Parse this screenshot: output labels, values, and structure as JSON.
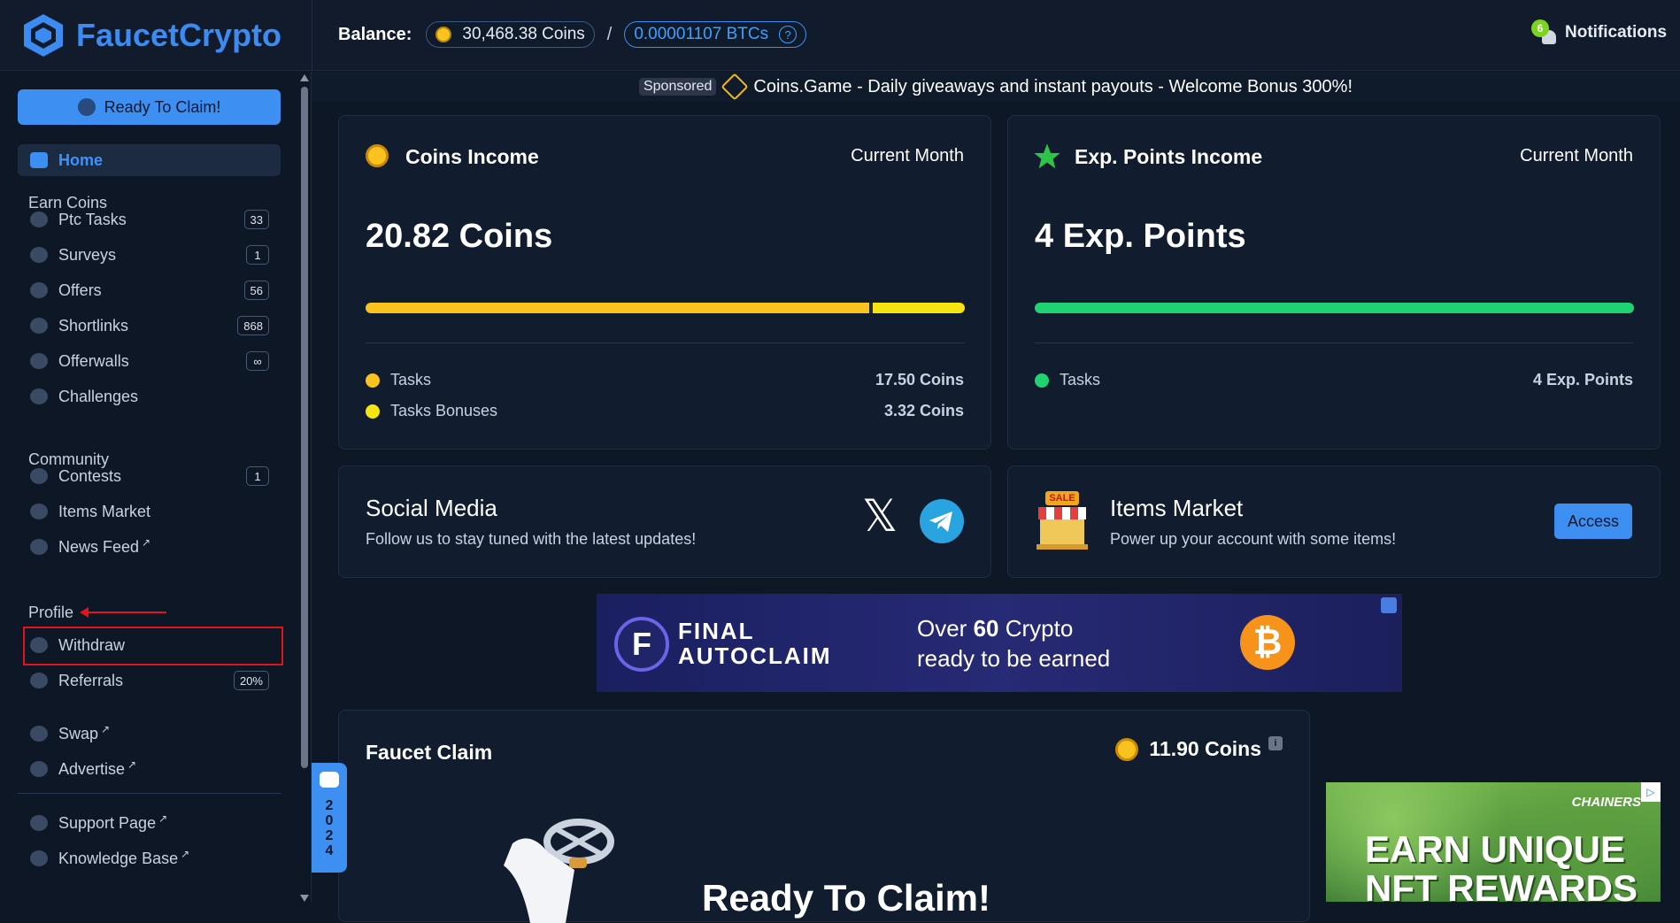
{
  "header": {
    "logo_text": "FaucetCrypto",
    "balance_label": "Balance:",
    "coins_balance": "30,468.38 Coins",
    "separator": "/",
    "btc_balance": "0.00001107 BTCs",
    "help_glyph": "?",
    "notifications_label": "Notifications",
    "notifications_count": "6"
  },
  "sidebar": {
    "claim_button": "Ready To Claim!",
    "home": "Home",
    "earn_section": "Earn Coins",
    "earn_items": [
      {
        "label": "Ptc Tasks",
        "badge": "33",
        "icon": "eye-icon"
      },
      {
        "label": "Surveys",
        "badge": "1",
        "icon": "survey-icon"
      },
      {
        "label": "Offers",
        "badge": "56",
        "icon": "offers-icon"
      },
      {
        "label": "Shortlinks",
        "badge": "868",
        "icon": "link-icon"
      },
      {
        "label": "Offerwalls",
        "badge": "∞",
        "icon": "wall-icon"
      },
      {
        "label": "Challenges",
        "badge": "",
        "icon": "target-icon"
      }
    ],
    "community_section": "Community",
    "community_items": [
      {
        "label": "Contests",
        "badge": "1",
        "icon": "trophy-icon"
      },
      {
        "label": "Items Market",
        "badge": "",
        "icon": "market-icon"
      },
      {
        "label": "News Feed",
        "ext": "↗",
        "icon": "news-icon"
      }
    ],
    "profile_section": "Profile",
    "profile_items": [
      {
        "label": "Withdraw",
        "icon": "withdraw-icon"
      },
      {
        "label": "Referrals",
        "badge": "20%",
        "icon": "referrals-icon"
      }
    ],
    "other_items": [
      {
        "label": "Swap",
        "ext": "↗",
        "icon": "swap-icon"
      },
      {
        "label": "Advertise",
        "ext": "↗",
        "icon": "advertise-icon"
      },
      {
        "label": "Support Page",
        "ext": "↗",
        "icon": "support-icon"
      },
      {
        "label": "Knowledge Base",
        "ext": "↗",
        "icon": "graduation-icon"
      }
    ]
  },
  "sponsor": {
    "tag": "Sponsored",
    "text": "Coins.Game - Daily giveaways and instant payouts - Welcome Bonus 300%!"
  },
  "coins_income": {
    "title": "Coins Income",
    "period": "Current Month",
    "total": "20.82 Coins",
    "rows": [
      {
        "label": "Tasks",
        "value": "17.50 Coins",
        "color": "#f9c21f",
        "share": 0.84
      },
      {
        "label": "Tasks Bonuses",
        "value": "3.32 Coins",
        "color": "#f5e312",
        "share": 0.16
      }
    ]
  },
  "exp_income": {
    "title": "Exp. Points Income",
    "period": "Current Month",
    "total": "4 Exp. Points",
    "rows": [
      {
        "label": "Tasks",
        "value": "4 Exp. Points",
        "color": "#1fd372",
        "share": 1.0
      }
    ]
  },
  "social": {
    "title": "Social Media",
    "subtitle": "Follow us to stay tuned with the latest updates!",
    "x_glyph": "𝕏"
  },
  "market": {
    "title": "Items Market",
    "subtitle": "Power up your account with some items!",
    "button": "Access",
    "sale_text": "SALE"
  },
  "banner": {
    "brand_line1": "FINAL",
    "brand_line2": "AUTOCLAIM",
    "text_prefix": "Over ",
    "text_num": "60",
    "text_suffix": " Crypto",
    "text_line2": "ready to be earned",
    "brand_letter": "F",
    "btc_glyph": "₿"
  },
  "faucet": {
    "title": "Faucet Claim",
    "reward": "11.90 Coins",
    "info_glyph": "i",
    "ready_text": "Ready To Claim!"
  },
  "chat_widget": {
    "year": [
      "2",
      "0",
      "2",
      "4"
    ]
  },
  "ad": {
    "brand": "CHAINERS",
    "line1": "EARN UNIQUE",
    "line2": "NFT REWARDS"
  }
}
